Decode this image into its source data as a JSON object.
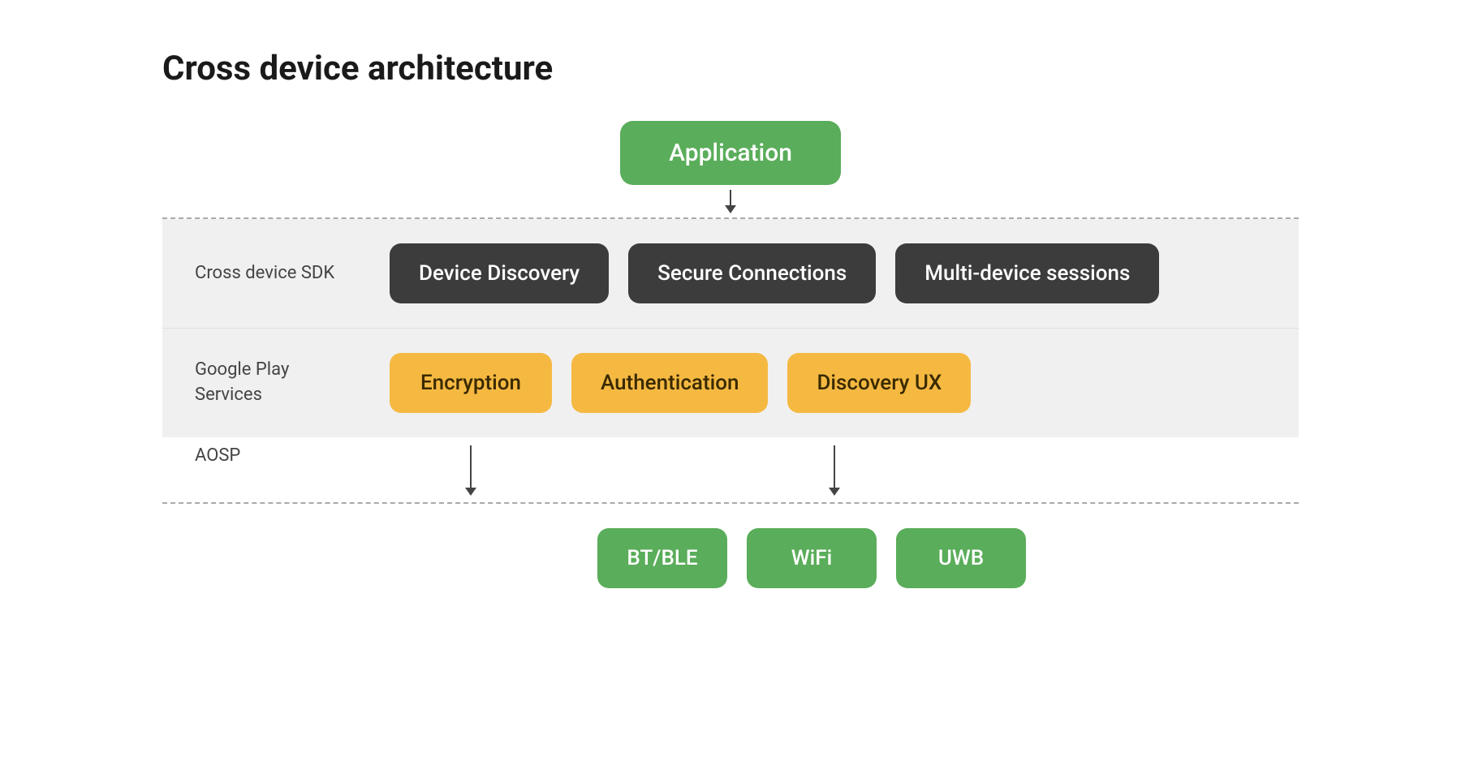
{
  "title": "Cross device architecture",
  "application_box": "Application",
  "sdk_label": "Cross device SDK",
  "sdk_items": [
    {
      "label": "Device Discovery"
    },
    {
      "label": "Secure Connections"
    },
    {
      "label": "Multi-device sessions"
    }
  ],
  "play_label": "Google Play Services",
  "play_items": [
    {
      "label": "Encryption"
    },
    {
      "label": "Authentication"
    },
    {
      "label": "Discovery UX"
    }
  ],
  "aosp_label": "AOSP",
  "bottom_items": [
    {
      "label": "BT/BLE"
    },
    {
      "label": "WiFi"
    },
    {
      "label": "UWB"
    }
  ]
}
